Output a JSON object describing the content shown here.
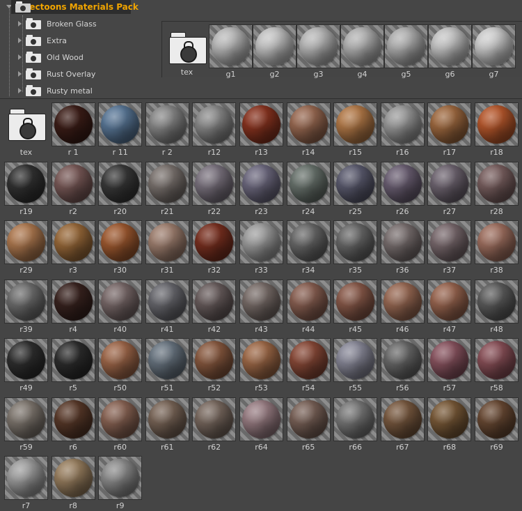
{
  "tree": {
    "root_label": "Stectoons Materials Pack",
    "items": [
      "Broken Glass",
      "Extra",
      "Old Wood",
      "Rust Overlay",
      "Rusty metal"
    ]
  },
  "glass_panel": {
    "tex_label": "tex",
    "items": [
      {
        "label": "g1",
        "color": "#bcbcbc"
      },
      {
        "label": "g2",
        "color": "#c6c6c6"
      },
      {
        "label": "g3",
        "color": "#b9b9b9"
      },
      {
        "label": "g4",
        "color": "#b4b4b4"
      },
      {
        "label": "g5",
        "color": "#b2b2b2"
      },
      {
        "label": "g6",
        "color": "#c7c7c7"
      },
      {
        "label": "g7",
        "color": "#d0d0d0"
      }
    ]
  },
  "rust_panel": {
    "tex_label": "tex",
    "items": [
      {
        "label": "r 1",
        "color": "#3d1e18"
      },
      {
        "label": "r 11",
        "color": "#5a7898"
      },
      {
        "label": "r 2",
        "color": "#8a8a8a"
      },
      {
        "label": "r12",
        "color": "#8c8c8c"
      },
      {
        "label": "r13",
        "color": "#8a3420"
      },
      {
        "label": "r14",
        "color": "#9a6a52"
      },
      {
        "label": "r15",
        "color": "#b47a48"
      },
      {
        "label": "r16",
        "color": "#9c9c9c"
      },
      {
        "label": "r17",
        "color": "#a06a40"
      },
      {
        "label": "r18",
        "color": "#b8582c"
      },
      {
        "label": "r19",
        "color": "#333333"
      },
      {
        "label": "r2",
        "color": "#7a5a58"
      },
      {
        "label": "r20",
        "color": "#3a3a3a"
      },
      {
        "label": "r21",
        "color": "#7c7470"
      },
      {
        "label": "r22",
        "color": "#7c7480"
      },
      {
        "label": "r23",
        "color": "#6e6a80"
      },
      {
        "label": "r24",
        "color": "#6a746e"
      },
      {
        "label": "r25",
        "color": "#5c5c70"
      },
      {
        "label": "r26",
        "color": "#6c6074"
      },
      {
        "label": "r27",
        "color": "#706672"
      },
      {
        "label": "r28",
        "color": "#7a6060"
      },
      {
        "label": "r29",
        "color": "#b07a50"
      },
      {
        "label": "r3",
        "color": "#9a6a3a"
      },
      {
        "label": "r30",
        "color": "#a05a30"
      },
      {
        "label": "r31",
        "color": "#a08070"
      },
      {
        "label": "r32",
        "color": "#7a3020"
      },
      {
        "label": "r33",
        "color": "#a0a0a0"
      },
      {
        "label": "r34",
        "color": "#6a6a6a"
      },
      {
        "label": "r35",
        "color": "#6a6a6a"
      },
      {
        "label": "r36",
        "color": "#7a7070"
      },
      {
        "label": "r37",
        "color": "#7a6a6e"
      },
      {
        "label": "r38",
        "color": "#a07060"
      },
      {
        "label": "r39",
        "color": "#707070"
      },
      {
        "label": "r4",
        "color": "#3a2420"
      },
      {
        "label": "r40",
        "color": "#7a6a6a"
      },
      {
        "label": "r41",
        "color": "#6a6a70"
      },
      {
        "label": "r42",
        "color": "#6a5e5e"
      },
      {
        "label": "r43",
        "color": "#7a6e6a"
      },
      {
        "label": "r44",
        "color": "#8a6052"
      },
      {
        "label": "r45",
        "color": "#8a5a4a"
      },
      {
        "label": "r46",
        "color": "#9a6a54"
      },
      {
        "label": "r47",
        "color": "#9a6650"
      },
      {
        "label": "r48",
        "color": "#5e5e5e"
      },
      {
        "label": "r49",
        "color": "#303030"
      },
      {
        "label": "r5",
        "color": "#2e2e2e"
      },
      {
        "label": "r50",
        "color": "#a0684a"
      },
      {
        "label": "r51",
        "color": "#6a7682"
      },
      {
        "label": "r52",
        "color": "#8a5a40"
      },
      {
        "label": "r53",
        "color": "#a06a48"
      },
      {
        "label": "r54",
        "color": "#8a4a38"
      },
      {
        "label": "r55",
        "color": "#8a8a9a"
      },
      {
        "label": "r56",
        "color": "#6a6a6a"
      },
      {
        "label": "r57",
        "color": "#8a5460"
      },
      {
        "label": "r58",
        "color": "#8a5058"
      },
      {
        "label": "r59",
        "color": "#807870"
      },
      {
        "label": "r6",
        "color": "#5a3a2a"
      },
      {
        "label": "r60",
        "color": "#8a6454"
      },
      {
        "label": "r61",
        "color": "#7a6658"
      },
      {
        "label": "r62",
        "color": "#7a6a60"
      },
      {
        "label": "r64",
        "color": "#9a7e84"
      },
      {
        "label": "r65",
        "color": "#7a6258"
      },
      {
        "label": "r66",
        "color": "#7a7a7a"
      },
      {
        "label": "r67",
        "color": "#7a5a40"
      },
      {
        "label": "r68",
        "color": "#7a5a38"
      },
      {
        "label": "r69",
        "color": "#6a4a34"
      },
      {
        "label": "r7",
        "color": "#a0a0a0"
      },
      {
        "label": "r8",
        "color": "#9a8060"
      },
      {
        "label": "r9",
        "color": "#8e8e8e"
      }
    ]
  }
}
